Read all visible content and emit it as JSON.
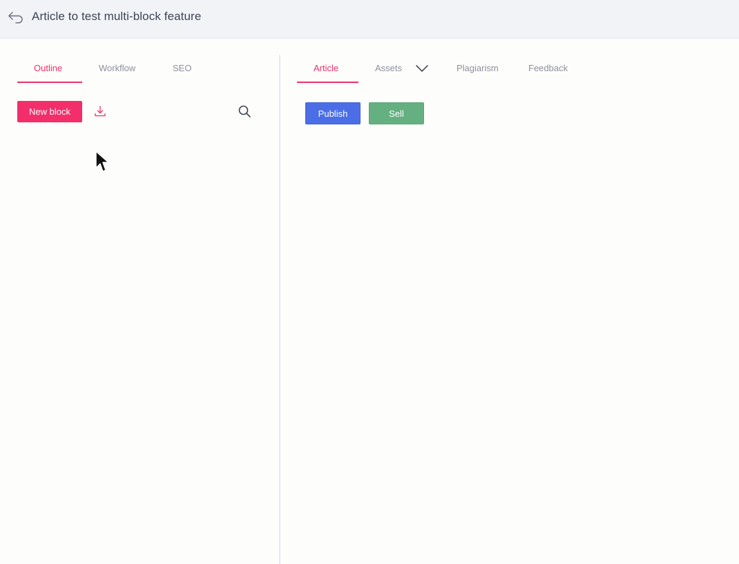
{
  "header": {
    "title": "Article to test multi-block feature",
    "back_icon": "back-arrow-icon"
  },
  "left_panel": {
    "tabs": [
      {
        "label": "Outline",
        "active": true
      },
      {
        "label": "Workflow",
        "active": false
      },
      {
        "label": "SEO",
        "active": false
      }
    ],
    "new_block_label": "New block",
    "download_icon": "download-icon",
    "search_icon": "search-icon"
  },
  "right_panel": {
    "tabs": [
      {
        "label": "Article",
        "active": true
      },
      {
        "label": "Assets",
        "active": false
      },
      {
        "label": "Plagiarism",
        "active": false
      },
      {
        "label": "Feedback",
        "active": false
      }
    ],
    "assets_chevron_icon": "chevron-down-icon",
    "publish_label": "Publish",
    "sell_label": "Sell"
  },
  "colors": {
    "accent": "#ee2f6a",
    "publish": "#4b6ee6",
    "sell": "#65b080",
    "topbar": "#f1f3f7"
  }
}
